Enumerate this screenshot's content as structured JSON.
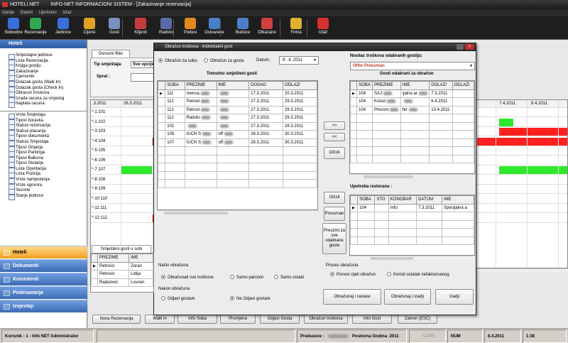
{
  "window": {
    "app": "HOTELI.NET",
    "title": "INFO-NET INFORMACIONI SISTEM - [Zakazivanje rezervacija]"
  },
  "menu": [
    "Opcije",
    "Export",
    "Upušstvo",
    "Izlaz"
  ],
  "toolbar": [
    {
      "label": "Slobodne",
      "icon": "home-icon",
      "color": "#3a6fd8"
    },
    {
      "label": "Rezervacije",
      "icon": "reservation-icon",
      "color": "#2fa84f"
    },
    {
      "label": "Jedinice",
      "icon": "units-icon",
      "color": "#3a6fd8"
    },
    {
      "label": "Cijene",
      "icon": "price-icon",
      "color": "#e0a020"
    },
    {
      "label": "Gosti",
      "icon": "guests-icon",
      "color": "#7a8fbf"
    },
    {
      "label": "Klijenti",
      "icon": "clients-icon",
      "color": "#c43c3c"
    },
    {
      "label": "Radnici",
      "icon": "workers-icon",
      "color": "#5a6aa8"
    },
    {
      "label": "Podesi",
      "icon": "settings-icon",
      "color": "#e08a20"
    },
    {
      "label": "Ostvarene",
      "icon": "realized-icon",
      "color": "#4a7fc8"
    },
    {
      "label": "Budúce",
      "icon": "future-icon",
      "color": "#4a7fc8"
    },
    {
      "label": "Otkazane",
      "icon": "cancelled-icon",
      "color": "#d04040"
    },
    {
      "label": "Firma",
      "icon": "company-icon",
      "color": "#e0b030"
    },
    {
      "label": "Izlaž",
      "icon": "exit-icon",
      "color": "#d83030"
    }
  ],
  "sidebar": {
    "header": "Hoteli",
    "group1": [
      "Smjestajne jedinice",
      "Lista Rezervacija",
      "Knjiga gostiju",
      "Zakazivanje",
      "Cjenovnik",
      "Dolazak gosta (Walk In)",
      "Dolazak gosta (Check In)",
      "Obracun troskova",
      "Izrada racuna za smjestaj",
      "Naplata racuna"
    ],
    "group2": [
      "Vrste Smjestaja",
      "Tipovi boravka",
      "Statusi rezervacija",
      "Statusi placanja",
      "Tipovi dokumenta",
      "Statusi Smjestaja",
      "Tipovi Grijanja",
      "Tipovi Parkinga",
      "Tipovi Balkona",
      "Tipovi Stolarije",
      "Lista Orjentacija",
      "Lista Pozicija",
      "Vrste namjestenja",
      "Vrste ugovora",
      "Sezone",
      "Stanje jedinice"
    ],
    "nav": [
      "Hoteli",
      "Dokumenti",
      "Komintenti",
      "Podesavanja",
      "Izvjestaji"
    ]
  },
  "main": {
    "tab": "Osnovni filter",
    "filter_label1": "Tip smještaja:",
    "filter_value1": "Sve opcije",
    "filter_label2": "Sprat :",
    "date_header_left": ".3.2011",
    "date_header_2": "26.3.2011",
    "date_header_right1": "7.4.2011",
    "date_header_right2": "8.4.2011",
    "rooms": [
      "*-1:101",
      "*-1:102",
      "*-3:103",
      "*-4:104",
      "*-5:105",
      "*-6:106",
      "*-7:107",
      "*-8:108",
      "*-9:109",
      "*-10:110",
      "*-11:111",
      "*-12:112"
    ],
    "guests_tab": "Smješteni gosti u sobi",
    "guests_headers": [
      "PREZIME",
      "IME"
    ],
    "guests_rows": [
      [
        "Petrovic",
        "Zoran"
      ],
      [
        "Petrovic",
        "Lidija"
      ],
      [
        "Radulovic",
        "Lovcen"
      ]
    ]
  },
  "bottom_buttons": [
    "Nova Rezervacija",
    "Walk in",
    "Info Soba",
    "Promjena",
    "Odjavi Gosta",
    "Obračun troškova",
    "Info Gost",
    "Zatvori (ESC)"
  ],
  "status": {
    "user": "Korisnik : 1 - Info NET  Administrator",
    "company_label": "Preduzece :",
    "year": "Poslovna Godina :2011",
    "caps": "CAPS",
    "num": "NUM",
    "date": "8.4.2011",
    "time": "1:38"
  },
  "dialog": {
    "title": "Obračun troškova - individualni gost",
    "radio_room": "Obračun za sobu",
    "radio_guest": "Obračun za gosta",
    "date_label": "Datum:",
    "date_value": "9 . 4 .2011",
    "payer_label": "Nosilac troškova odabranih gostiju:",
    "payer_value": "Offer Pressman",
    "left_title": "Trenutno smješteni gosti",
    "left_headers": [
      "SOBA",
      "PREZIME",
      "IME",
      "DOSAO",
      "ODLAZI"
    ],
    "left_rows": [
      [
        "111",
        "mensa",
        "",
        "17.3.2011",
        "20.3.2011"
      ],
      [
        "112",
        "Petrovi",
        "",
        "27.3.2011",
        "29.3.2011"
      ],
      [
        "112",
        "Petrovi",
        "",
        "27.3.2011",
        "29.3.2011"
      ],
      [
        "112",
        "Radulo",
        "",
        "27.3.2011",
        "29.3.2011"
      ],
      [
        "101",
        "",
        "",
        "27.3.2011",
        "28.3.2011"
      ],
      [
        "105",
        "IUCN S",
        "off",
        "28.3.2011",
        "30.3.2011"
      ],
      [
        "107",
        "IUCN S",
        "off",
        "28.3.2011",
        "30.3.2011"
      ]
    ],
    "right_title": "Gosti odabrani za obračun",
    "right_headers": [
      "SOBA",
      "PREZIME",
      "IME",
      "DOLAZI",
      "ODLAZI"
    ],
    "right_rows": [
      [
        "104",
        "SAJ",
        "ijalna ar",
        "7.3.2011",
        ""
      ],
      [
        "104",
        "Kolozi",
        "",
        "6.4.2011",
        ""
      ],
      [
        "104",
        "Pressm",
        "fer",
        "10.4.2011",
        ""
      ]
    ],
    "btn_add": ">>",
    "btn_remove": "<<",
    "btn_clear1": "Očisti",
    "btn_clear2": "Očisti",
    "btn_pressman": "Pressman",
    "btn_restaurant": "Preuzmi za sve odabrane goste",
    "rest_title": "Upotreba restorana :",
    "rest_headers": [
      "SOBA",
      "STO",
      "KONOBAR",
      "DATUM",
      "IME"
    ],
    "rest_rows": [
      [
        "104",
        "",
        "Info",
        "7.3.2011",
        "Specijalna a"
      ]
    ],
    "calc_label": "Način obračuna",
    "calc_all": "Obračunati sve troškove",
    "calc_pension": "Samo pansion",
    "calc_rest": "Samo ostalo",
    "after_label": "Nakon obračuna",
    "after_checkout": "Odjavi gosta/e",
    "after_no": "Ne Odjavi gosta/e",
    "process_label": "Proces obračuna",
    "process_repeat": "Ponovi cijeli obračun",
    "process_rest": "Koristi ostatak nefakturisanog",
    "btn_continue": "Obračunaj i nastavi",
    "btn_exit": "Obračunaj i izadji",
    "btn_leave": "Izadji"
  }
}
